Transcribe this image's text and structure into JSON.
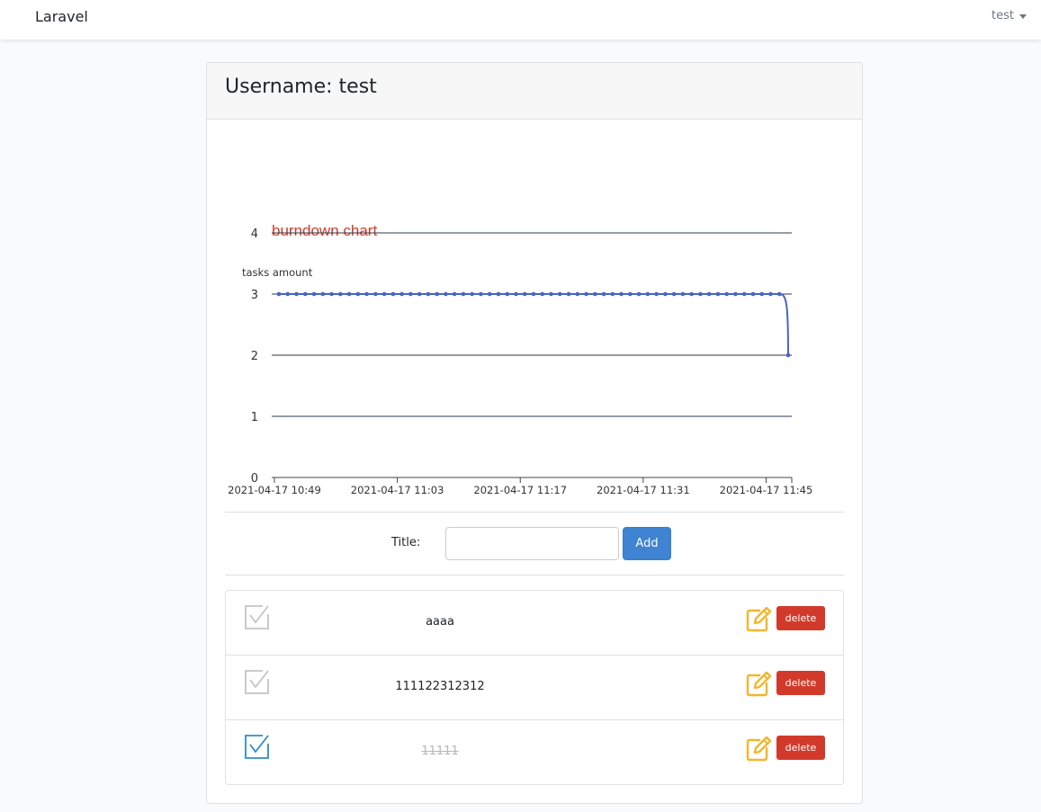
{
  "navbar": {
    "brand": "Laravel",
    "user": "test"
  },
  "card": {
    "header": "Username: test"
  },
  "chart_data": {
    "type": "line",
    "title": "burndown chart",
    "ylabel": "tasks amount",
    "xlabel": "",
    "ylim": [
      0,
      4
    ],
    "yticks": [
      "0",
      "1",
      "2",
      "3",
      "4"
    ],
    "xtick_labels": [
      "2021-04-17 10:49",
      "2021-04-17 11:03",
      "2021-04-17 11:17",
      "2021-04-17 11:31",
      "2021-04-17 11:45"
    ],
    "x": [
      "10:49",
      "10:50",
      "10:51",
      "10:52",
      "10:53",
      "10:54",
      "10:55",
      "10:56",
      "10:57",
      "10:58",
      "10:59",
      "11:00",
      "11:01",
      "11:02",
      "11:03",
      "11:04",
      "11:05",
      "11:06",
      "11:07",
      "11:08",
      "11:09",
      "11:10",
      "11:11",
      "11:12",
      "11:13",
      "11:14",
      "11:15",
      "11:16",
      "11:17",
      "11:18",
      "11:19",
      "11:20",
      "11:21",
      "11:22",
      "11:23",
      "11:24",
      "11:25",
      "11:26",
      "11:27",
      "11:28",
      "11:29",
      "11:30",
      "11:31",
      "11:32",
      "11:33",
      "11:34",
      "11:35",
      "11:36",
      "11:37",
      "11:38",
      "11:39",
      "11:40",
      "11:41",
      "11:42",
      "11:43",
      "11:44",
      "11:45",
      "11:46",
      "11:47"
    ],
    "values": [
      3,
      3,
      3,
      3,
      3,
      3,
      3,
      3,
      3,
      3,
      3,
      3,
      3,
      3,
      3,
      3,
      3,
      3,
      3,
      3,
      3,
      3,
      3,
      3,
      3,
      3,
      3,
      3,
      3,
      3,
      3,
      3,
      3,
      3,
      3,
      3,
      3,
      3,
      3,
      3,
      3,
      3,
      3,
      3,
      3,
      3,
      3,
      3,
      3,
      3,
      3,
      3,
      3,
      3,
      3,
      3,
      3,
      3,
      2
    ],
    "grid": true,
    "colors": {
      "title": "#d13a2b",
      "line": "#4a63c4",
      "grid": "#2e3a48"
    }
  },
  "form": {
    "title_label": "Title:",
    "title_value": "",
    "add_label": "Add"
  },
  "tasks": [
    {
      "title": "aaaa",
      "done": false,
      "edit_icon": "pencil-square-icon",
      "delete_label": "delete"
    },
    {
      "title": "111122312312",
      "done": false,
      "edit_icon": "pencil-square-icon",
      "delete_label": "delete"
    },
    {
      "title": "11111",
      "done": true,
      "edit_icon": "pencil-square-icon",
      "delete_label": "delete"
    }
  ],
  "colors": {
    "checkbox_off": "#c2c4c6",
    "checkbox_on": "#2e8bd0",
    "edit": "#f3b62b",
    "delete": "#d13a2b",
    "add": "#3f83d2"
  }
}
